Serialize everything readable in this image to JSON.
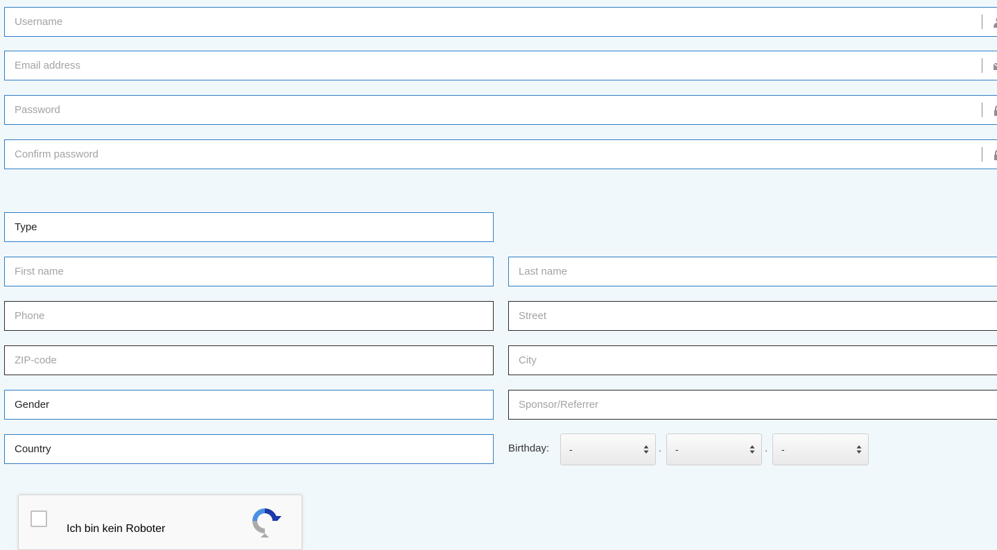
{
  "account": {
    "username_placeholder": "Username",
    "email_placeholder": "Email address",
    "password_placeholder": "Password",
    "confirm_password_placeholder": "Confirm password"
  },
  "profile": {
    "type_label": "Type",
    "first_name_placeholder": "First name",
    "last_name_placeholder": "Last name",
    "phone_placeholder": "Phone",
    "street_placeholder": "Street",
    "zip_placeholder": "ZIP-code",
    "city_placeholder": "City",
    "gender_label": "Gender",
    "sponsor_placeholder": "Sponsor/Referrer",
    "country_label": "Country",
    "birthday_label": "Birthday:",
    "birthday_day": "-",
    "birthday_month": "-",
    "birthday_year": "-",
    "birthday_separator": "."
  },
  "captcha": {
    "label": "Ich bin kein Roboter"
  },
  "icons": {
    "username": "user-icon",
    "email": "envelope-icon",
    "password": "lock-icon",
    "confirm_password": "lock-icon",
    "captcha_logo": "recaptcha-logo"
  },
  "colors": {
    "background": "#f1f8fc",
    "field_border_accent": "#2f7dc4",
    "field_border_dark": "#2b2b2b",
    "placeholder_text": "#a3a3a3"
  }
}
